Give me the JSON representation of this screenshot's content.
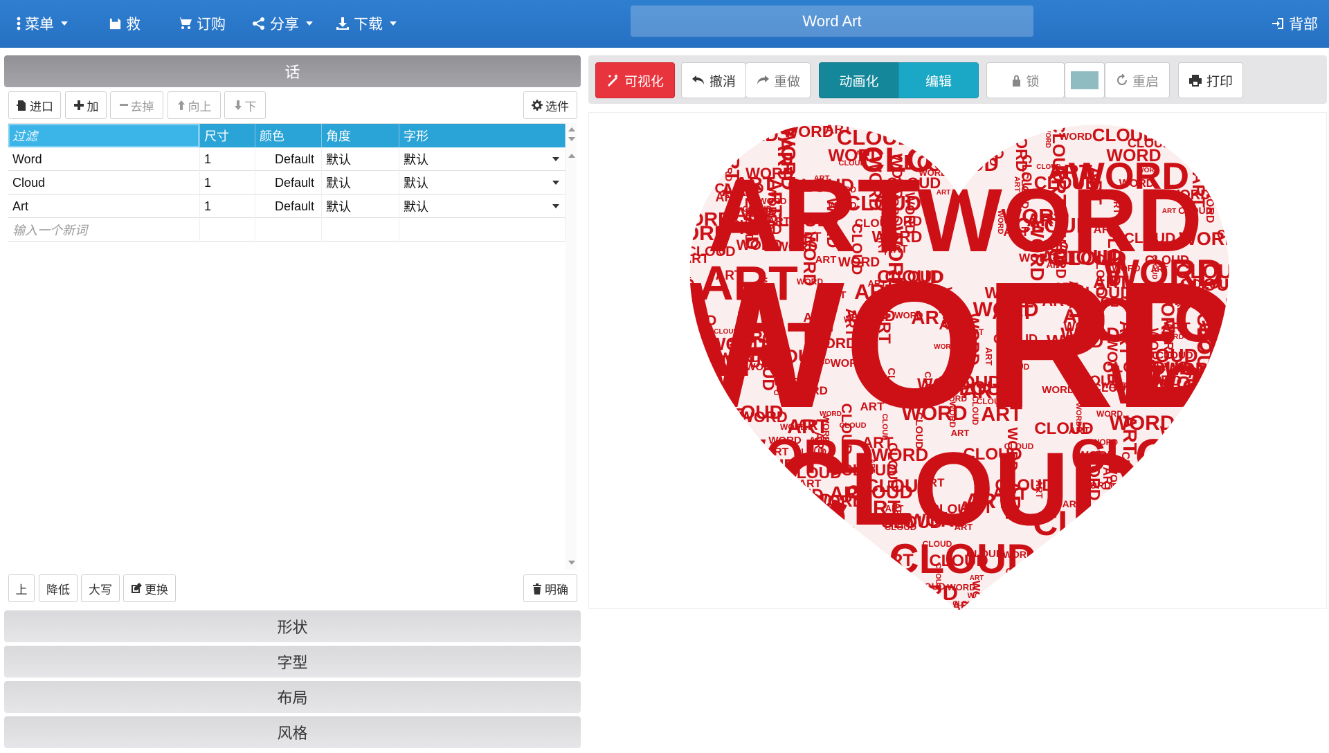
{
  "topbar": {
    "menu_label": "菜单",
    "save_label": "救",
    "order_label": "订购",
    "share_label": "分享",
    "download_label": "下载",
    "title": "Word Art",
    "back_label": "背部"
  },
  "words_panel": {
    "header": "话",
    "toolbar": {
      "import_label": "进口",
      "add_label": "加",
      "remove_label": "去掉",
      "up_label": "向上",
      "down_label": "下",
      "options_label": "选件"
    },
    "columns": {
      "filter": "过滤",
      "size": "尺寸",
      "color": "颜色",
      "angle": "角度",
      "font": "字形"
    },
    "rows": [
      {
        "word": "Word",
        "size": "1",
        "color": "Default",
        "angle": "默认",
        "font": "默认"
      },
      {
        "word": "Cloud",
        "size": "1",
        "color": "Default",
        "angle": "默认",
        "font": "默认"
      },
      {
        "word": "Art",
        "size": "1",
        "color": "Default",
        "angle": "默认",
        "font": "默认"
      }
    ],
    "new_word_placeholder": "输入一个新词",
    "bottom": {
      "upper_label": "上",
      "lower_label": "降低",
      "caps_label": "大写",
      "replace_label": "更换",
      "clear_label": "明确"
    }
  },
  "sections": {
    "shapes": "形状",
    "fonts": "字型",
    "layout": "布局",
    "style": "风格"
  },
  "right_toolbar": {
    "visualize_label": "可视化",
    "undo_label": "撤消",
    "redo_label": "重做",
    "animate_label": "动画化",
    "edit_label": "编辑",
    "lock_label": "锁",
    "reset_label": "重启",
    "print_label": "打印"
  },
  "cloud": {
    "words": [
      "WORD",
      "CLOUD",
      "ART"
    ],
    "shape": "heart",
    "color": "#cc1016"
  },
  "colors": {
    "accent_blue": "#2aa3d6",
    "visualize_red": "#e8343c",
    "animate_teal": "#15879a",
    "edit_teal": "#1ba7c6",
    "swatch": "#8fbcc0"
  }
}
